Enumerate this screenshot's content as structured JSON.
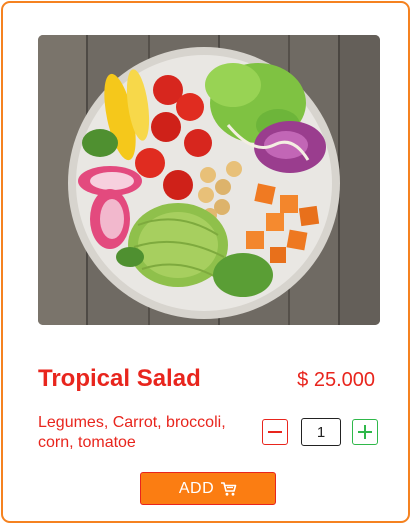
{
  "product": {
    "name": "Tropical Salad",
    "price": "$ 25.000",
    "description": "Legumes, Carrot, broccoli, corn, tomatoe",
    "image_alt": "salad-bowl"
  },
  "quantity": {
    "value": "1",
    "decrement_label": "−",
    "increment_label": "+"
  },
  "actions": {
    "add_label": "ADD",
    "add_icon": "cart-icon"
  },
  "colors": {
    "accent": "#f58220",
    "title": "#e8251d",
    "button_bg": "#fb7d12",
    "increment": "#2fb84a"
  }
}
